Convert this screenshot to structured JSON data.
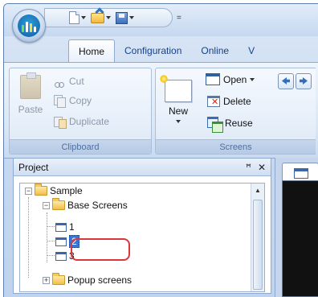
{
  "qat": {
    "more_glyph": "="
  },
  "tabs": [
    "Home",
    "Configuration",
    "Online",
    "V"
  ],
  "ribbon": {
    "clipboard": {
      "label": "Clipboard",
      "paste": "Paste",
      "cut": "Cut",
      "copy": "Copy",
      "duplicate": "Duplicate"
    },
    "screens": {
      "label": "Screens",
      "new": "New",
      "open": "Open",
      "delete": "Delete",
      "reuse": "Reuse"
    }
  },
  "project": {
    "title": "Project",
    "pin_glyph": "ꟸ",
    "close_glyph": "✕",
    "tree": {
      "root": "Sample",
      "base_screens": "Base Screens",
      "items": [
        "1",
        "2",
        "3"
      ],
      "popup": "Popup screens"
    }
  },
  "colors": {
    "selection": "#3875d7",
    "highlight": "#d9373b",
    "ribbon_text": "#15428b"
  }
}
